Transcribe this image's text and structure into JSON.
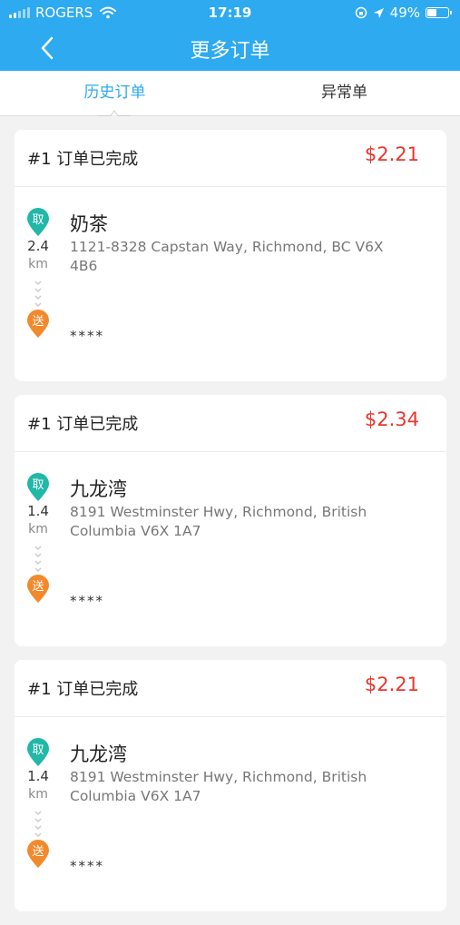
{
  "status_bar": {
    "carrier": "ROGERS",
    "time": "17:19",
    "battery": "49%",
    "battery_level": 0.49
  },
  "nav": {
    "title": "更多订单"
  },
  "tabs": [
    {
      "label": "历史订单",
      "active": true
    },
    {
      "label": "异常单",
      "active": false
    }
  ],
  "orders": [
    {
      "status": "#1 订单已完成",
      "price": "$2.21",
      "pickup_badge": "取",
      "distance": "2.4",
      "unit": "km",
      "shop": "奶茶",
      "address_line1": "1121-8328 Capstan Way, Richmond, BC V6X",
      "address_line2": "4B6",
      "delivery_badge": "送",
      "recipient": "****"
    },
    {
      "status": "#1 订单已完成",
      "price": "$2.34",
      "pickup_badge": "取",
      "distance": "1.4",
      "unit": "km",
      "shop": "九龙湾",
      "address_line1": "8191 Westminster Hwy, Richmond, British",
      "address_line2": "Columbia V6X 1A7",
      "delivery_badge": "送",
      "recipient": "****"
    },
    {
      "status": "#1 订单已完成",
      "price": "$2.21",
      "pickup_badge": "取",
      "distance": "1.4",
      "unit": "km",
      "shop": "九龙湾",
      "address_line1": "8191 Westminster Hwy, Richmond, British",
      "address_line2": "Columbia V6X 1A7",
      "delivery_badge": "送",
      "recipient": "****"
    }
  ],
  "colors": {
    "brand": "#2daaf0",
    "price": "#e8372d",
    "pickup": "#21b8a8",
    "delivery": "#f28a2c"
  }
}
